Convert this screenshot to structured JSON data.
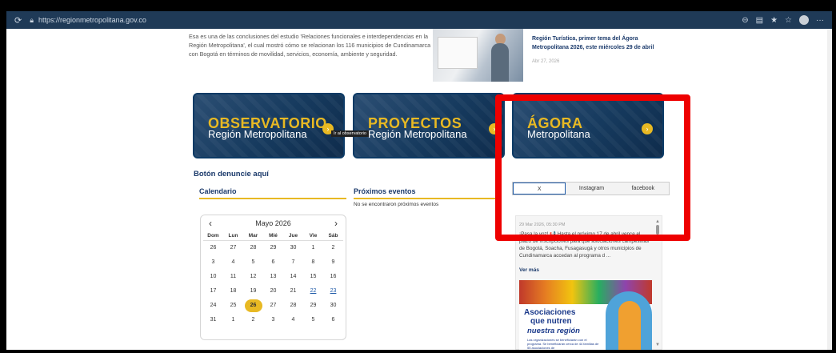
{
  "browser": {
    "reload_icon": "reload-icon",
    "url": "https://regionmetropolitana.gov.co"
  },
  "intro_text": "Esa es una de las conclusiones del estudio 'Relaciones funcionales e interdependencias en la Región Metropolitana', el cual mostró cómo se relacionan los 116 municipios de Cundinamarca con Bogotá en términos de movilidad, servicios, economía, ambiente y seguridad.",
  "news": {
    "title": "Región Turística, primer tema del Ágora Metropolitana 2026, este miércoles 29 de abril",
    "date": "Abr 27, 2026"
  },
  "cards": [
    {
      "title": "OBSERVATORIO",
      "subtitle": "Región Metropolitana"
    },
    {
      "title": "PROYECTOS",
      "subtitle": "Región Metropolitana"
    },
    {
      "title": "ÁGORA",
      "subtitle": "Metropolitana"
    }
  ],
  "tooltip": "Ir al observatorio",
  "denuncie": "Botón denuncie aquí",
  "calendar": {
    "heading": "Calendario",
    "month": "Mayo 2026",
    "prev": "‹",
    "next": "›",
    "weekdays": [
      "Dom",
      "Lun",
      "Mar",
      "Mié",
      "Jue",
      "Vie",
      "Sáb"
    ],
    "weeks": [
      [
        "26",
        "27",
        "28",
        "29",
        "30",
        "1",
        "2"
      ],
      [
        "3",
        "4",
        "5",
        "6",
        "7",
        "8",
        "9"
      ],
      [
        "10",
        "11",
        "12",
        "13",
        "14",
        "15",
        "16"
      ],
      [
        "17",
        "18",
        "19",
        "20",
        "21",
        "22",
        "23"
      ],
      [
        "24",
        "25",
        "26",
        "27",
        "28",
        "29",
        "30"
      ],
      [
        "31",
        "1",
        "2",
        "3",
        "4",
        "5",
        "6"
      ]
    ],
    "today": "26"
  },
  "events": {
    "heading": "Próximos eventos",
    "empty": "No se encontraron próximos eventos"
  },
  "social": {
    "tabs": [
      "X",
      "Instagram",
      "facebook"
    ],
    "active": "X"
  },
  "feed": {
    "time": "29 Mar 2026, 05:30 PM",
    "text": "¡Pasa la voz! 📢 Hasta el próximo 17 de abril vence el plazo de inscripciones para que asociaciones campesinas de Bogotá, Soacha, Fusagasugá y otros municipios de Cundinamarca accedan al programa d ...",
    "more": "Ver más",
    "img_line1": "Asociaciones",
    "img_line2": "que nutren",
    "img_line3": "nuestra región",
    "img_small": "Las organizaciones se beneficiarán con el programa. Se beneficiarán cerca de 44 familias de 55 asociaciones de"
  },
  "colors": {
    "accent_yellow": "#e8b923",
    "navy": "#1b3a6b",
    "highlight_red": "#ee0000"
  }
}
